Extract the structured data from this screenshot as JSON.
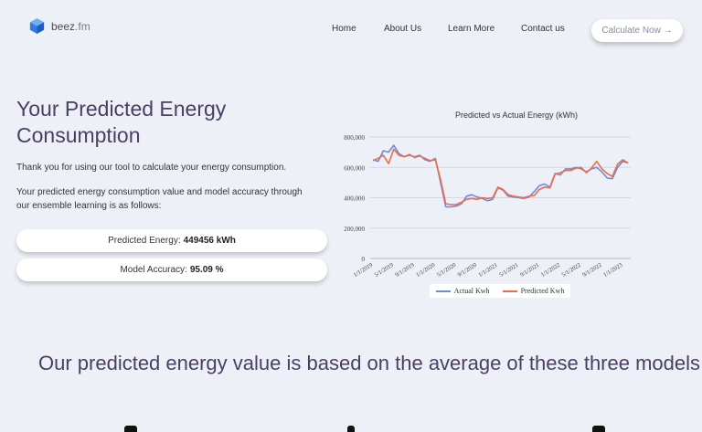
{
  "brand": {
    "name": "beez",
    "tld": ".fm",
    "logo_icon": "cube-icon",
    "logo_color": "#2f7be0"
  },
  "nav": {
    "items": [
      "Home",
      "About Us",
      "Learn More",
      "Contact us"
    ],
    "cta": "Calculate Now →"
  },
  "hero": {
    "title": "Your Predicted Energy Consumption",
    "thanks": "Thank you for using our tool to calculate your energy consumption.",
    "description": "Your predicted energy consumption value and model accuracy through our ensemble learning is as follows:",
    "predicted_label": "Predicted Energy:",
    "predicted_value": "449456 kWh",
    "accuracy_label": "Model Accuracy:",
    "accuracy_value": "95.09 %"
  },
  "section": {
    "heading": "Our predicted energy value is based on the average of these three models"
  },
  "chart_data": {
    "type": "line",
    "title": "Predicted vs Actual Energy (kWh)",
    "xlabel": "",
    "ylabel": "",
    "ylim": [
      0,
      800000
    ],
    "yticks": [
      "0",
      "200,000",
      "400,000",
      "600,000",
      "800,000"
    ],
    "x_tick_labels": [
      "1/1/2019",
      "5/1/2019",
      "9/1/2019",
      "1/1/2020",
      "5/1/2020",
      "9/1/2020",
      "1/1/2021",
      "5/1/2021",
      "9/1/2021",
      "1/1/2022",
      "5/1/2022",
      "9/1/2022",
      "1/1/2023"
    ],
    "x_start": "1/1/2019",
    "x_end": "3/1/2023",
    "grid": true,
    "legend": "bottom",
    "series": [
      {
        "name": "Actual Kwh",
        "color": "#6b8fd6",
        "values": [
          650000,
          640000,
          710000,
          700000,
          745000,
          690000,
          670000,
          680000,
          670000,
          680000,
          650000,
          640000,
          660000,
          500000,
          340000,
          340000,
          345000,
          360000,
          410000,
          420000,
          405000,
          395000,
          380000,
          390000,
          465000,
          450000,
          410000,
          405000,
          400000,
          395000,
          405000,
          440000,
          480000,
          490000,
          470000,
          560000,
          550000,
          590000,
          590000,
          600000,
          590000,
          570000,
          590000,
          600000,
          570000,
          530000,
          525000,
          600000,
          640000,
          630000
        ]
      },
      {
        "name": "Predicted Kwh",
        "color": "#ef6b4a",
        "values": [
          645000,
          660000,
          680000,
          625000,
          720000,
          680000,
          670000,
          685000,
          665000,
          675000,
          660000,
          645000,
          650000,
          520000,
          360000,
          355000,
          355000,
          370000,
          390000,
          395000,
          390000,
          400000,
          395000,
          400000,
          470000,
          455000,
          420000,
          410000,
          405000,
          400000,
          410000,
          415000,
          455000,
          470000,
          465000,
          555000,
          565000,
          580000,
          580000,
          595000,
          600000,
          565000,
          595000,
          640000,
          590000,
          560000,
          540000,
          620000,
          650000,
          630000
        ]
      }
    ]
  }
}
